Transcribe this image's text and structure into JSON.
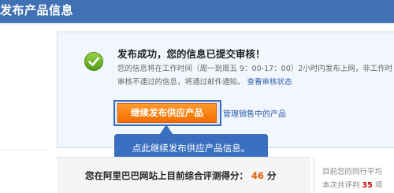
{
  "header": {
    "title": "发布产品信息"
  },
  "success": {
    "title": "发布成功，您的信息已提交审核！",
    "line1": "您的信息将在工作时间（周一到周五 9：00-17：00）2小时内发布上网，非工作时",
    "line2_text": "审核不通过的信息，将通过邮件通知。",
    "line2_link": "查看审核状态"
  },
  "actions": {
    "continue_label": "继续发布供应产品",
    "manage_link": "管理销售中的产品"
  },
  "tooltip": {
    "text": "点此继续发布供应产品信息。"
  },
  "score": {
    "label": "您在阿里巴巴网站上目前综合评测得分：",
    "value": "46",
    "unit": "分"
  },
  "side": {
    "line1": "目前您的同行平均",
    "line2_prefix": "本次共评判",
    "line2_count": "35",
    "line2_suffix": "项"
  },
  "colors": {
    "header_bg": "#3f71b4",
    "button_orange": "#f26d00",
    "tooltip_blue": "#3a6fc0",
    "score_orange": "#e25a00"
  },
  "icons": {
    "success": "check-circle-icon"
  }
}
